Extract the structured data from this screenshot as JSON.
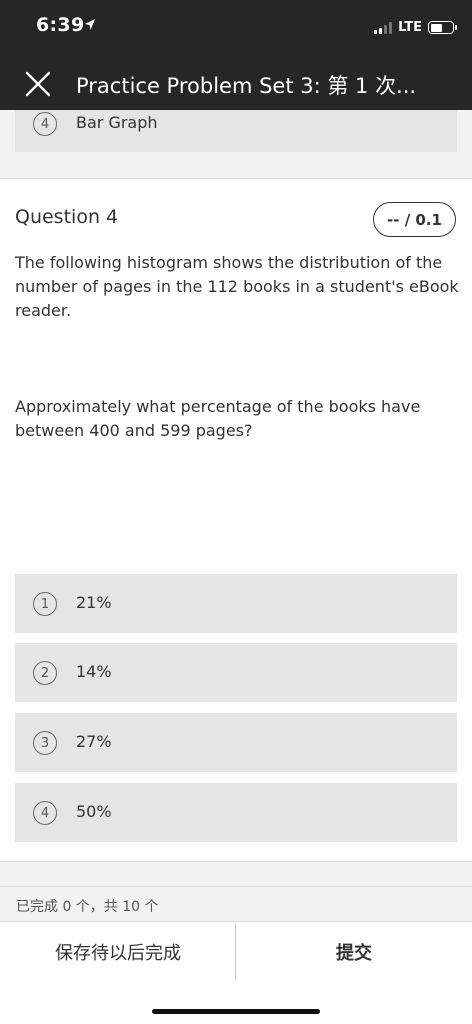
{
  "status_bar": {
    "time": "6:39",
    "location_icon": "location-arrow-icon",
    "network": "LTE",
    "signal_icon": "signal-bars-icon",
    "battery_icon": "battery-icon"
  },
  "nav": {
    "close_icon": "close-icon",
    "title": "Practice Problem Set 3: 第 1 次..."
  },
  "previous_option": {
    "number": "4",
    "label": "Bar Graph"
  },
  "question": {
    "title": "Question 4",
    "score": "-- / 0.1",
    "prompt": "The following histogram shows the distribution of the number of pages in the 112 books in a student's eBook reader.",
    "ask": "Approximately what percentage of the books have between 400 and 599 pages?",
    "options": [
      {
        "number": "1",
        "label": "21%"
      },
      {
        "number": "2",
        "label": "14%"
      },
      {
        "number": "3",
        "label": "27%"
      },
      {
        "number": "4",
        "label": "50%"
      }
    ]
  },
  "progress": {
    "text": "已完成 0 个，共 10 个"
  },
  "footer": {
    "save_label": "保存待以后完成",
    "submit_label": "提交"
  },
  "colors": {
    "header_bg": "#262626",
    "option_bg": "#e5e5e5",
    "page_bg": "#f2f2f2"
  }
}
